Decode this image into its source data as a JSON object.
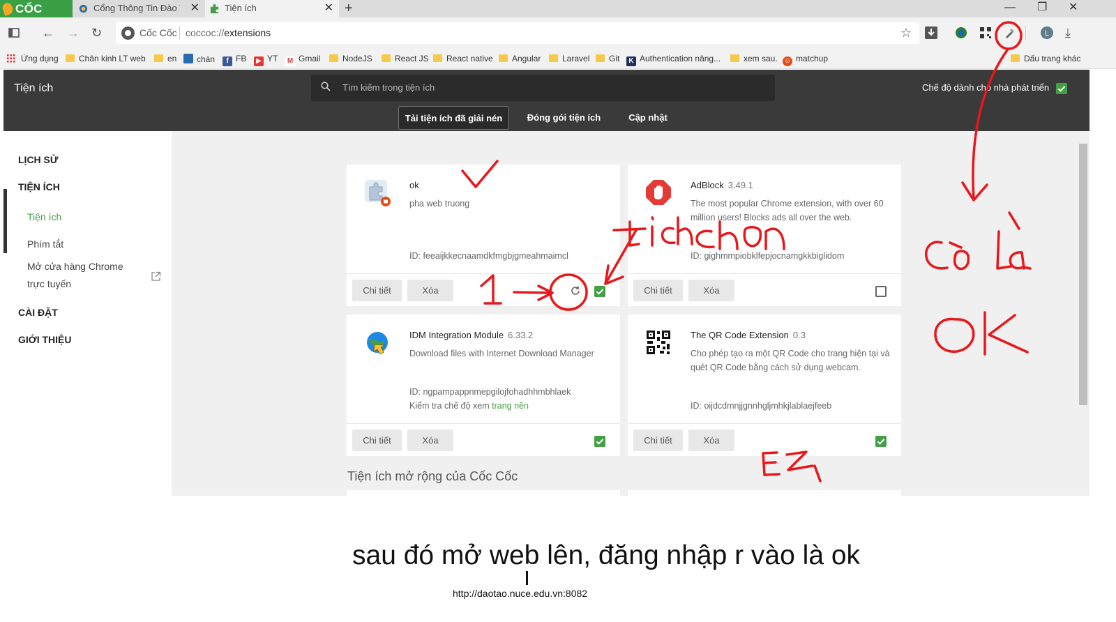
{
  "browser": {
    "brand": "CỐC CỐC",
    "tabs": [
      {
        "title": "Cổng Thông Tin Đào Tạo"
      },
      {
        "title": "Tiện ích"
      }
    ],
    "address": {
      "brand": "Cốc Cốc",
      "scheme": "coccoc://",
      "path": "extensions"
    },
    "bookmarks": [
      "Ứng dụng",
      "Chân kinh LT web",
      "en",
      "chán",
      "FB",
      "YT",
      "Gmail",
      "NodeJS",
      "React JS",
      "React native",
      "Angular",
      "Laravel",
      "Git",
      "Authentication nâng...",
      "xem sau.",
      "matchup",
      "Dấu trang khác"
    ],
    "profile_initial": "L"
  },
  "header": {
    "title": "Tiện ích",
    "search_placeholder": "Tìm kiếm trong tiện ích",
    "dev_mode": "Chế độ dành cho nhà phát triển",
    "subtabs": [
      "Tải tiện ích đã giải nén",
      "Đóng gói tiện ích",
      "Cập nhật"
    ]
  },
  "sidebar": {
    "history": "LỊCH SỬ",
    "extensions": "TIỆN ÍCH",
    "items": [
      "Tiện ích",
      "Phím tắt",
      "Mở cửa hàng Chrome",
      "trực tuyến"
    ],
    "settings": "CÀI ĐẶT",
    "about": "GIỚI THIỆU"
  },
  "buttons": {
    "detail": "Chi tiết",
    "remove": "Xóa"
  },
  "extensions": [
    {
      "name": "ok",
      "version": "",
      "desc": "pha web truong",
      "id": "ID: feeaijkkecnaamdkfmgbjgmeahmaimcl",
      "enabled": true
    },
    {
      "name": "AdBlock",
      "version": "3.49.1",
      "desc": "The most popular Chrome extension, with over 60 million users! Blocks ads all over the web.",
      "id": "ID: gighmmpiobklfepjocnamgkkbiglidom",
      "enabled": false
    },
    {
      "name": "IDM Integration Module",
      "version": "6.33.2",
      "desc": "Download files with Internet Download Manager",
      "id": "ID: ngpampappnmepgilojfohadhhmbhlaek",
      "note": "Kiểm tra chế độ xem ",
      "note_link": "trang nền",
      "enabled": true
    },
    {
      "name": "The QR Code Extension",
      "version": "0.3",
      "desc": "Cho phép tạo ra một QR Code cho trang hiện tại và quét QR Code bằng cách sử dụng webcam.",
      "id": "ID: oijdcdmnjjgnnhgljmhkjlablaejfeeb",
      "enabled": true
    }
  ],
  "section_title": "Tiện ích mở rộng của Cốc Cốc",
  "caption": "sau đó mở web lên, đăng nhập r vào là ok",
  "url_note": "http://daotao.nuce.edu.vn:8082",
  "annotations": {
    "tick_text": "tích chọn",
    "step": "1",
    "right_text_1": "Có là",
    "right_text_2": "OK",
    "ez": "EZ",
    "ink_color": "#e8171b"
  },
  "colors": {
    "accent_green": "#43a047",
    "header_dark": "#3a3a3a",
    "brand_green": "#3aa046"
  }
}
